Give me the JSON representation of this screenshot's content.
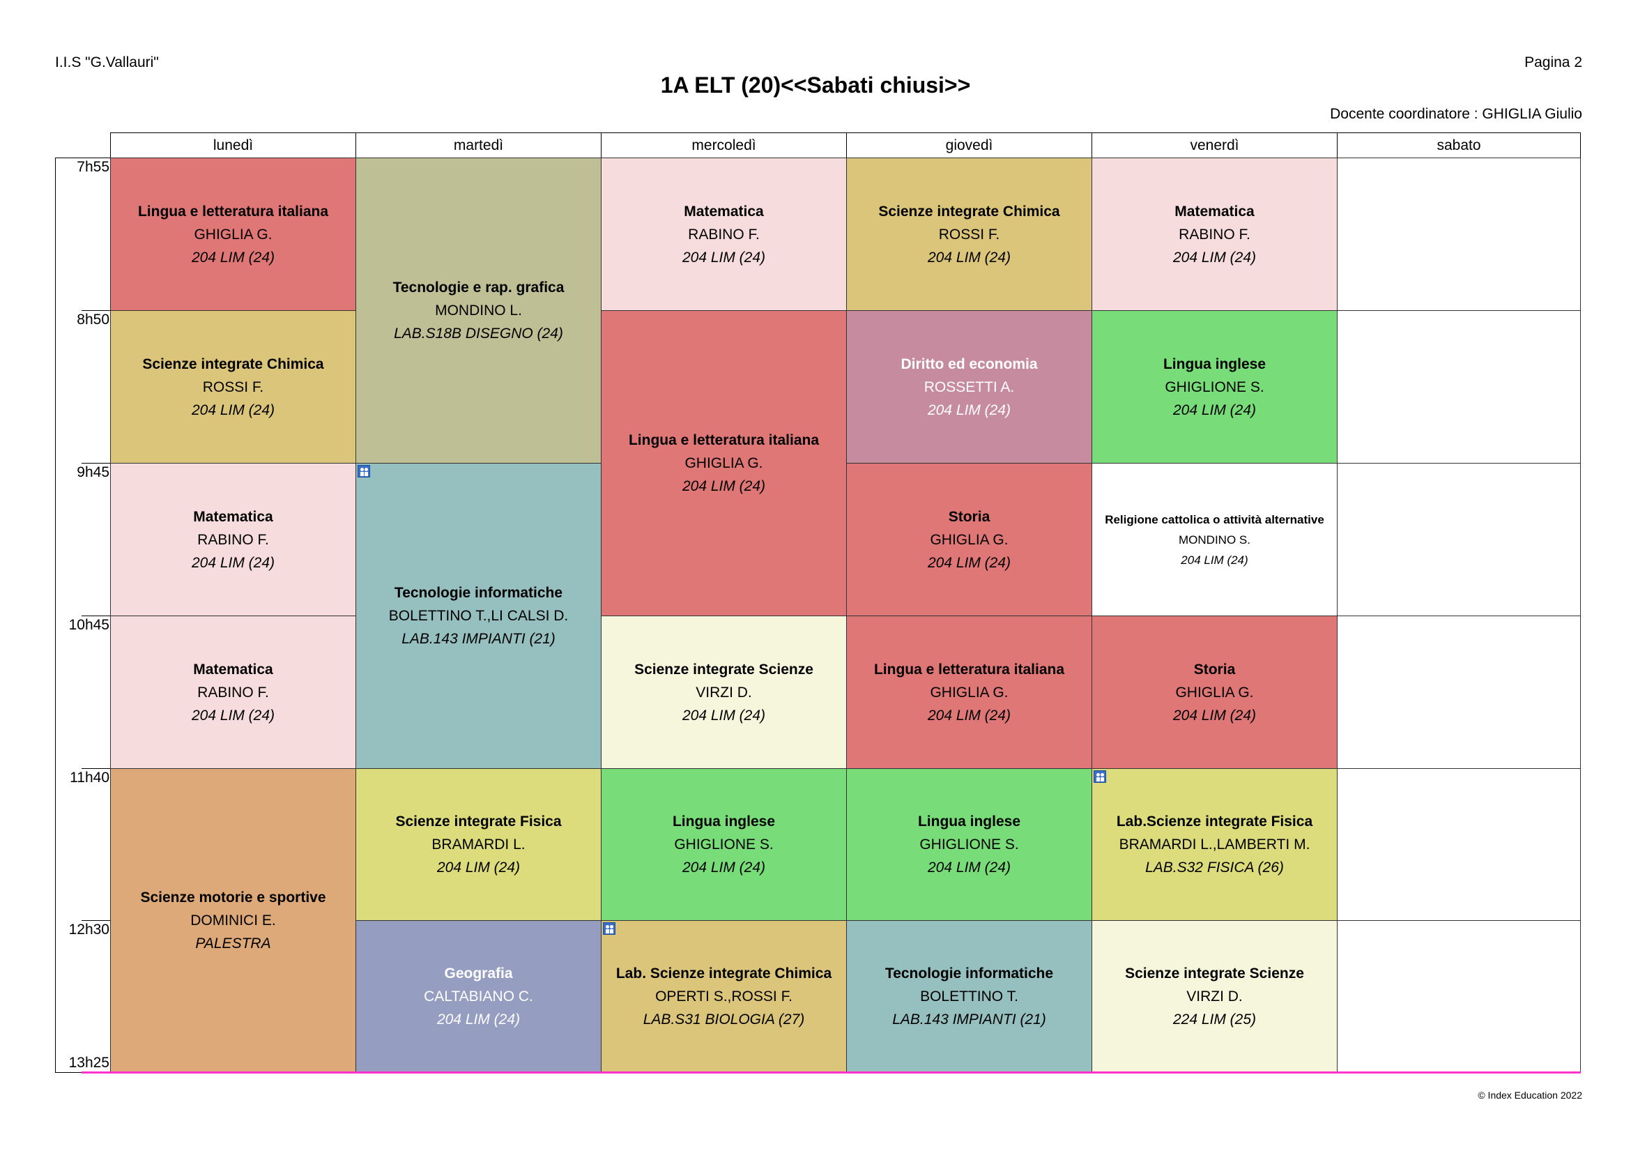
{
  "header": {
    "school": "I.I.S \"G.Vallauri\"",
    "page": "Pagina 2",
    "title": "1A ELT (20)<<Sabati chiusi>>",
    "coordinator": "Docente coordinatore : GHIGLIA Giulio"
  },
  "days": [
    "lunedì",
    "martedì",
    "mercoledì",
    "giovedì",
    "venerdì",
    "sabato"
  ],
  "times": [
    "7h55",
    "8h50",
    "9h45",
    "10h45",
    "11h40",
    "12h30",
    "13h25"
  ],
  "lessons": [
    {
      "subject": "Lingua e letteratura italiana",
      "teacher": "GHIGLIA G.",
      "room": "204 LIM (24)",
      "color": "#de7775"
    },
    {
      "subject": "Scienze integrate Chimica",
      "teacher": "ROSSI F.",
      "room": "204 LIM (24)",
      "color": "#dbc57b"
    },
    {
      "subject": "Matematica",
      "teacher": "RABINO F.",
      "room": "204 LIM (24)",
      "color": "#f6dcdc"
    },
    {
      "subject": "Matematica",
      "teacher": "RABINO F.",
      "room": "204 LIM (24)",
      "color": "#f6dcdc"
    },
    {
      "subject": "Scienze motorie e sportive",
      "teacher": "DOMINICI E.",
      "room": "PALESTRA",
      "color": "#dea978"
    },
    {
      "subject": "Tecnologie  e rap. grafica",
      "teacher": "MONDINO L.",
      "room": "LAB.S18B DISEGNO (24)",
      "color": "#bebf94"
    },
    {
      "subject": "Tecnologie informatiche",
      "teacher": "BOLETTINO T.,LI CALSI D.",
      "room": "LAB.143 IMPIANTI (21)",
      "color": "#96bfbf"
    },
    {
      "subject": "Scienze integrate Fisica",
      "teacher": "BRAMARDI L.",
      "room": "204 LIM (24)",
      "color": "#dddc7c"
    },
    {
      "subject": "Geografia",
      "teacher": "CALTABIANO C.",
      "room": "204 LIM (24)",
      "color": "#959dc0"
    },
    {
      "subject": "Matematica",
      "teacher": "RABINO F.",
      "room": "204 LIM (24)",
      "color": "#f6dcdc"
    },
    {
      "subject": "Lingua e letteratura italiana",
      "teacher": "GHIGLIA G.",
      "room": "204 LIM (24)",
      "color": "#de7775"
    },
    {
      "subject": "Scienze integrate Scienze",
      "teacher": "VIRZI D.",
      "room": "204 LIM (24)",
      "color": "#f6f6dc"
    },
    {
      "subject": "Lingua inglese",
      "teacher": "GHIGLIONE S.",
      "room": "204 LIM (24)",
      "color": "#78dd78"
    },
    {
      "subject": "Lab. Scienze integrate Chimica",
      "teacher": "OPERTI S.,ROSSI F.",
      "room": "LAB.S31 BIOLOGIA (27)",
      "color": "#dbc57b"
    },
    {
      "subject": "Scienze integrate Chimica",
      "teacher": "ROSSI F.",
      "room": "204 LIM (24)",
      "color": "#dbc57b"
    },
    {
      "subject": "Diritto ed economia",
      "teacher": "ROSSETTI A.",
      "room": "204 LIM (24)",
      "color": "#c78ba0"
    },
    {
      "subject": "Storia",
      "teacher": "GHIGLIA G.",
      "room": "204 LIM (24)",
      "color": "#de7775"
    },
    {
      "subject": "Lingua e letteratura italiana",
      "teacher": "GHIGLIA G.",
      "room": "204 LIM (24)",
      "color": "#de7775"
    },
    {
      "subject": "Lingua inglese",
      "teacher": "GHIGLIONE S.",
      "room": "204 LIM (24)",
      "color": "#78dd78"
    },
    {
      "subject": "Tecnologie informatiche",
      "teacher": "BOLETTINO T.",
      "room": "LAB.143 IMPIANTI (21)",
      "color": "#96bfbf"
    },
    {
      "subject": "Matematica",
      "teacher": "RABINO F.",
      "room": "204 LIM (24)",
      "color": "#f6dcdc"
    },
    {
      "subject": "Lingua inglese",
      "teacher": "GHIGLIONE S.",
      "room": "204 LIM (24)",
      "color": "#78dd78"
    },
    {
      "subject": "Religione cattolica o attività alternative",
      "teacher": "MONDINO S.",
      "room": "204 LIM (24)",
      "color": "#ffffff"
    },
    {
      "subject": "Storia",
      "teacher": "GHIGLIA G.",
      "room": "204 LIM (24)",
      "color": "#de7775"
    },
    {
      "subject": "Lab.Scienze integrate Fisica",
      "teacher": "BRAMARDI L.,LAMBERTI M.",
      "room": "LAB.S32 FISICA (26)",
      "color": "#dddc7c"
    },
    {
      "subject": "Scienze integrate Scienze",
      "teacher": "VIRZI D.",
      "room": "224 LIM (25)",
      "color": "#f6f6dc"
    }
  ],
  "footer": "© Index Education 2022"
}
